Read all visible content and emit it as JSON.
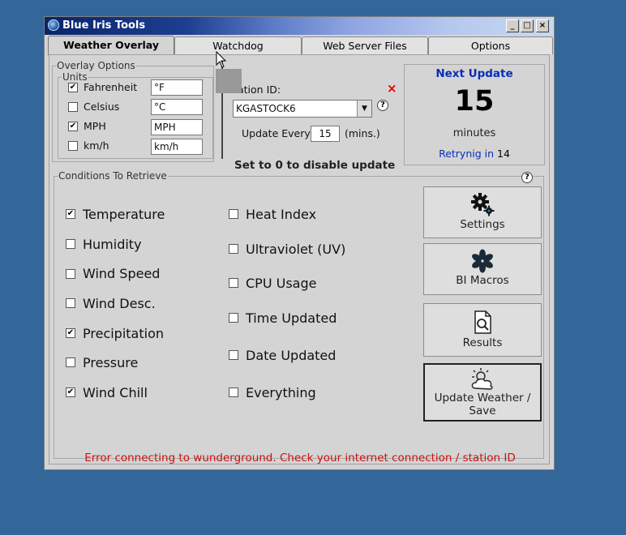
{
  "window": {
    "title": "Blue Iris Tools"
  },
  "tabs": [
    "Weather Overlay",
    "Watchdog",
    "Web Server Files",
    "Options"
  ],
  "overlay_options": {
    "legend": "Overlay Options",
    "units_legend": "Units",
    "units": [
      {
        "label": "Fahrenheit",
        "checked": true,
        "value": "°F"
      },
      {
        "label": "Celsius",
        "checked": false,
        "value": "°C"
      },
      {
        "label": "MPH",
        "checked": true,
        "value": "MPH"
      },
      {
        "label": "km/h",
        "checked": false,
        "value": "km/h"
      }
    ]
  },
  "station": {
    "label": "ation ID:",
    "value": "KGASTOCK6",
    "update_every_label": "Update Every",
    "update_every_value": "15",
    "mins_label": "(mins.)",
    "disable_note": "Set to 0 to disable update",
    "close_mark": "×",
    "help": "?"
  },
  "next_update": {
    "title": "Next Update",
    "value": "15",
    "unit": "minutes",
    "retry_label": "Retrynig in",
    "retry_value": "14"
  },
  "conditions": {
    "legend": "Conditions To Retrieve",
    "help": "?",
    "left": [
      {
        "label": "Temperature",
        "checked": true
      },
      {
        "label": "Humidity",
        "checked": false
      },
      {
        "label": "Wind Speed",
        "checked": false
      },
      {
        "label": "Wind Desc.",
        "checked": false
      },
      {
        "label": "Precipitation",
        "checked": true
      },
      {
        "label": "Pressure",
        "checked": false
      },
      {
        "label": "Wind Chill",
        "checked": true
      }
    ],
    "right": [
      {
        "label": "Heat Index",
        "checked": false
      },
      {
        "label": "Ultraviolet (UV)",
        "checked": false
      },
      {
        "label": "CPU Usage",
        "checked": false
      },
      {
        "label": "Time Updated",
        "checked": false
      },
      {
        "label": "Date Updated",
        "checked": false
      },
      {
        "label": "Everything",
        "checked": false
      }
    ]
  },
  "buttons": {
    "settings": "Settings",
    "macros": "BI Macros",
    "results": "Results",
    "update_line1": "Update Weather /",
    "update_line2": "Save"
  },
  "error": {
    "text": "Error connecting to wunderground. Check your internet connection / station ID",
    "color": "#d01010"
  },
  "colors": {
    "desktop": "#336699",
    "accent": "#0a2db8"
  }
}
